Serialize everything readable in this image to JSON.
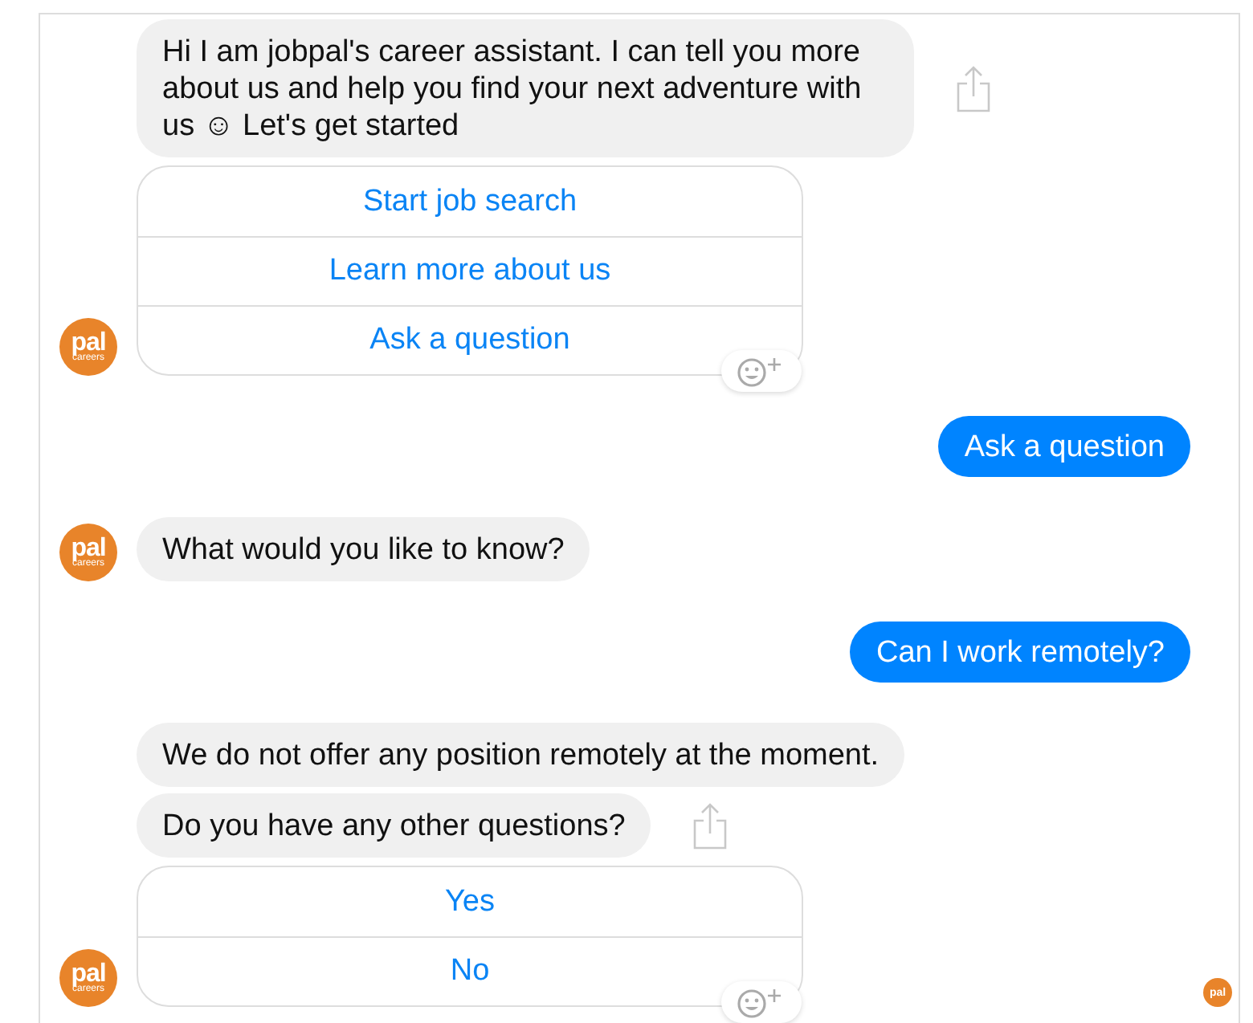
{
  "conversation": [
    {
      "kind": "bot",
      "messages": [
        {
          "text": "Hi I am jobpal's career assistant. I can tell you more about us and help you find your next adventure with us ☺ Let's get started",
          "share": true
        }
      ],
      "quick_replies": [
        {
          "label": "Start job search"
        },
        {
          "label": "Learn more about us"
        },
        {
          "label": "Ask a question"
        }
      ],
      "reaction_button": true,
      "avatar": {
        "logo": "pal",
        "tagline": "careers"
      }
    },
    {
      "kind": "user",
      "messages": [
        {
          "text": "Ask a question"
        }
      ]
    },
    {
      "kind": "bot",
      "messages": [
        {
          "text": "What would you like to know?",
          "share": false
        }
      ],
      "avatar": {
        "logo": "pal",
        "tagline": "careers"
      }
    },
    {
      "kind": "user",
      "messages": [
        {
          "text": "Can I work remotely?"
        }
      ]
    },
    {
      "kind": "bot",
      "messages": [
        {
          "text": "We do not offer any position remotely at the moment.",
          "share": false
        },
        {
          "text": "Do you have any other questions?",
          "share": true
        }
      ],
      "quick_replies": [
        {
          "label": "Yes"
        },
        {
          "label": "No"
        }
      ],
      "reaction_button": true,
      "avatar": {
        "logo": "pal",
        "tagline": "careers"
      },
      "read_receipt": {
        "logo": "pal"
      }
    }
  ]
}
